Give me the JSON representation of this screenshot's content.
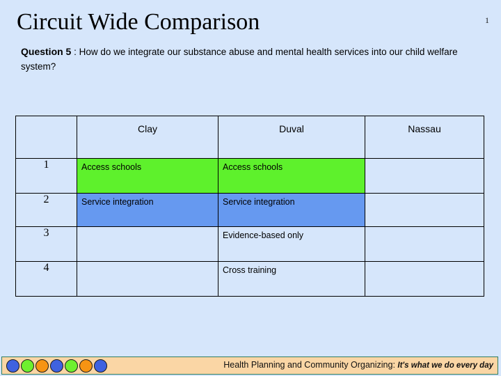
{
  "slide": {
    "title": "Circuit Wide Comparison",
    "page_number": "1",
    "background_color": "#d6e6fb"
  },
  "question": {
    "label": "Question 5",
    "separator": " : ",
    "text": "How do we integrate our substance abuse and mental health services into our child welfare system?"
  },
  "table": {
    "columns": [
      "",
      "Clay",
      "Duval",
      "Nassau"
    ],
    "rows": [
      {
        "index": "1",
        "clay": "Access schools",
        "duval": "Access schools",
        "nassau": "",
        "clay_fill": "#5ef12c",
        "duval_fill": "#5ef12c"
      },
      {
        "index": "2",
        "clay": "Service integration",
        "duval": "Service integration",
        "nassau": "",
        "clay_fill": "#6699f0",
        "duval_fill": "#6699f0"
      },
      {
        "index": "3",
        "clay": "",
        "duval": "Evidence-based only",
        "nassau": "",
        "clay_fill": "#d6e6fb",
        "duval_fill": "#d6e6fb"
      },
      {
        "index": "4",
        "clay": "",
        "duval": "Cross training",
        "nassau": "",
        "clay_fill": "#d6e6fb",
        "duval_fill": "#d6e6fb"
      }
    ]
  },
  "footer": {
    "organization": "Health Planning and Community Organizing:",
    "tagline": "It's what we do every day",
    "bar_color": "#fad6a5",
    "border_color": "#2e7d64",
    "dots": [
      {
        "color": "#3f62e0"
      },
      {
        "color": "#6ef02e"
      },
      {
        "color": "#f79413"
      },
      {
        "color": "#3f62e0"
      },
      {
        "color": "#6ef02e"
      },
      {
        "color": "#f79413"
      },
      {
        "color": "#3f62e0"
      }
    ]
  }
}
